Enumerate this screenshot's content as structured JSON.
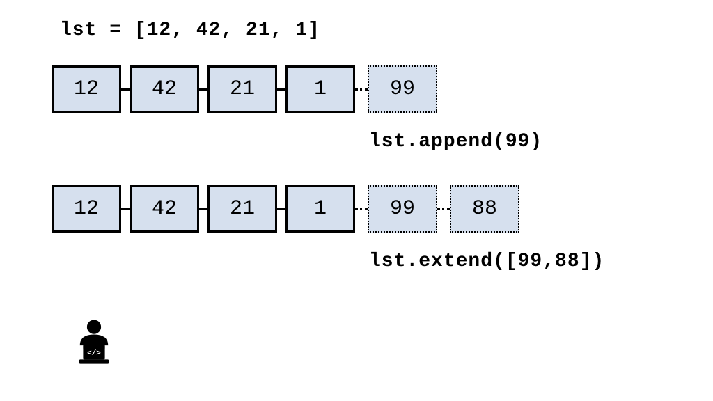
{
  "header_code": "lst = [12, 42, 21, 1]",
  "row1": {
    "solid": [
      "12",
      "42",
      "21",
      "1"
    ],
    "dashed": [
      "99"
    ],
    "label": "lst.append(99)"
  },
  "row2": {
    "solid": [
      "12",
      "42",
      "21",
      "1"
    ],
    "dashed": [
      "99",
      "88"
    ],
    "label": "lst.extend([99,88])"
  },
  "icon_name": "coder-icon"
}
